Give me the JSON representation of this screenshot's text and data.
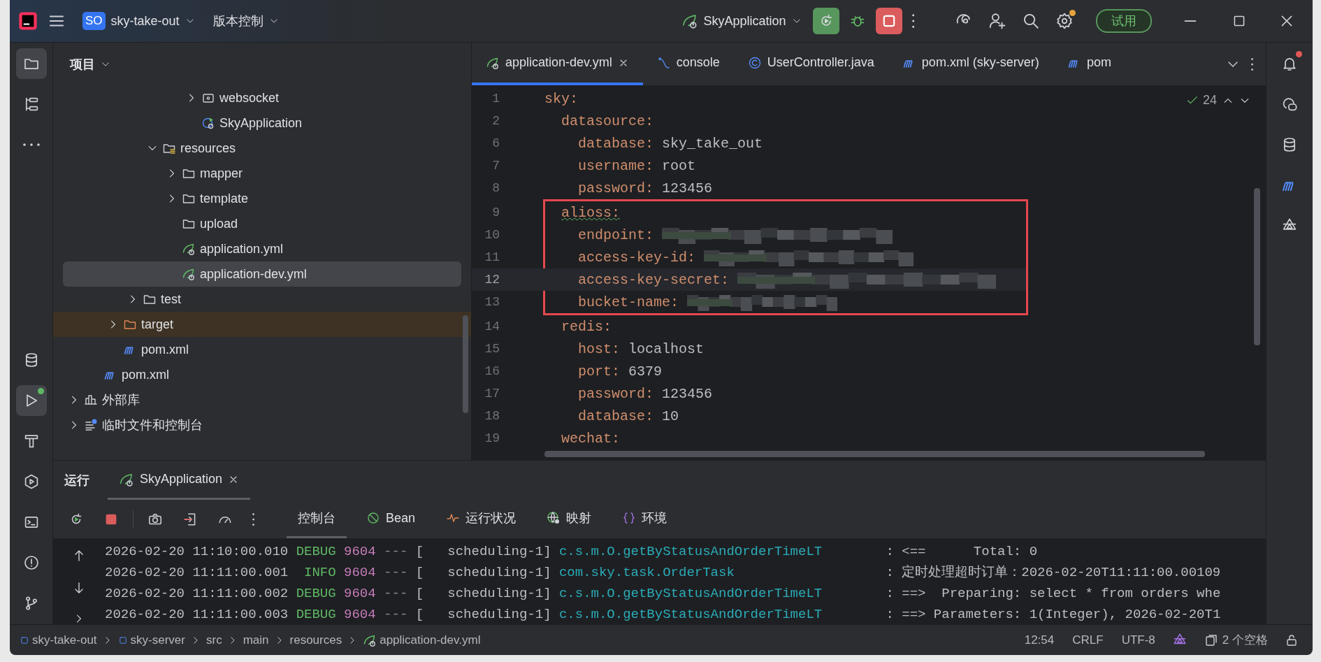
{
  "title_bar": {
    "project_initials": "SO",
    "project_name": "sky-take-out",
    "vcs_menu": "版本控制",
    "run_configuration": "SkyApplication",
    "trial_button": "试用",
    "settings_badge": true
  },
  "left_tools": [
    {
      "kind": "project",
      "selected": true,
      "badge": false
    },
    {
      "kind": "structure",
      "selected": false,
      "badge": false
    },
    {
      "kind": "more",
      "selected": false,
      "badge": false
    }
  ],
  "left_tools_bottom": [
    {
      "kind": "database",
      "selected": false,
      "badge": false
    },
    {
      "kind": "run",
      "selected": true,
      "badge": true
    },
    {
      "kind": "build",
      "selected": false,
      "badge": false
    },
    {
      "kind": "services",
      "selected": false,
      "badge": false
    },
    {
      "kind": "terminal",
      "selected": false,
      "badge": false
    },
    {
      "kind": "problems",
      "selected": false,
      "badge": false
    },
    {
      "kind": "git",
      "selected": false,
      "badge": false
    }
  ],
  "right_tools": [
    {
      "kind": "notifications",
      "selected": false,
      "badge": true
    },
    {
      "kind": "ai-chat",
      "selected": false,
      "badge": false
    },
    {
      "kind": "database",
      "selected": false,
      "badge": false
    },
    {
      "kind": "maven",
      "selected": false,
      "badge": false
    },
    {
      "kind": "ai",
      "selected": false,
      "badge": false
    }
  ],
  "project_panel": {
    "title": "项目",
    "tree": [
      {
        "children": [
          {
            "children": [
              {
                "children": [
                  {
                    "children": [
                      {
                        "children": [
                          {
                            "children": [
                              {
                                "label": "websocket",
                                "kind": "package",
                                "selected": false,
                                "expanded": false
                              },
                              {
                                "label": "SkyApplication",
                                "kind": "app",
                                "selected": false
                              }
                            ]
                          }
                        ]
                      },
                      {
                        "label": "resources",
                        "kind": "resources",
                        "selected": false,
                        "expanded": true,
                        "children": [
                          {
                            "label": "mapper",
                            "kind": "folder",
                            "selected": false,
                            "expanded": false
                          },
                          {
                            "label": "template",
                            "kind": "folder",
                            "selected": false,
                            "expanded": false
                          },
                          {
                            "label": "upload",
                            "kind": "folder",
                            "selected": false
                          },
                          {
                            "label": "application.yml",
                            "kind": "spring",
                            "selected": false
                          },
                          {
                            "label": "application-dev.yml",
                            "kind": "spring",
                            "selected": true
                          }
                        ]
                      }
                    ]
                  },
                  {
                    "label": "test",
                    "kind": "folder",
                    "selected": false,
                    "expanded": false
                  }
                ]
              },
              {
                "label": "target",
                "kind": "excluded",
                "selected": false,
                "expanded": false
              },
              {
                "label": "pom.xml",
                "kind": "maven",
                "selected": false
              }
            ]
          },
          {
            "label": "pom.xml",
            "kind": "maven",
            "selected": false
          }
        ]
      },
      {
        "label": "外部库",
        "kind": "library",
        "selected": false,
        "expanded": false
      },
      {
        "label": "临时文件和控制台",
        "kind": "scratch",
        "selected": false,
        "expanded": false
      }
    ]
  },
  "editor": {
    "tabs": [
      {
        "label": "application-dev.yml",
        "kind": "spring",
        "selected": true
      },
      {
        "label": "console",
        "kind": "sql",
        "selected": false
      },
      {
        "label": "UserController.java",
        "kind": "class",
        "selected": false
      },
      {
        "label": "pom.xml (sky-server)",
        "kind": "maven",
        "selected": false
      },
      {
        "label": "pom",
        "kind": "maven",
        "selected": false
      }
    ],
    "inspection_count": "24",
    "code": [
      {
        "line": "1",
        "key": "sky:",
        "current": false,
        "children": [
          {
            "line": "2",
            "key": "datasource:",
            "current": false,
            "children": [
              {
                "line": "6",
                "key": "database:",
                "value": "sky_take_out",
                "current": false
              },
              {
                "line": "7",
                "key": "username:",
                "value": "root",
                "current": false
              },
              {
                "line": "8",
                "key": "password:",
                "value": "123456",
                "current": false
              }
            ]
          },
          {
            "line": "9",
            "key": "alioss:",
            "current": false,
            "spell_warning": true,
            "annotated": true,
            "children": [
              {
                "line": "10",
                "key": "endpoint:",
                "current": false,
                "redacted": true
              },
              {
                "line": "11",
                "key": "access-key-id:",
                "current": false,
                "redacted": true
              },
              {
                "line": "12",
                "key": "access-key-secret:",
                "current": true,
                "redacted": true
              },
              {
                "line": "13",
                "key": "bucket-name:",
                "current": false,
                "redacted": true
              }
            ]
          },
          {
            "line": "14",
            "key": "redis:",
            "current": false,
            "children": [
              {
                "line": "15",
                "key": "host:",
                "value": "localhost",
                "current": false
              },
              {
                "line": "16",
                "key": "port:",
                "value": "6379",
                "current": false
              },
              {
                "line": "17",
                "key": "password:",
                "value": "123456",
                "current": false
              },
              {
                "line": "18",
                "key": "database:",
                "value": "10",
                "current": false
              }
            ]
          },
          {
            "line": "19",
            "key": "wechat:",
            "current": false
          }
        ]
      }
    ]
  },
  "run_panel": {
    "title": "运行",
    "tabs": [
      {
        "label": "SkyApplication",
        "selected": true
      }
    ],
    "sub_tabs": [
      {
        "label": "控制台",
        "kind": "console",
        "selected": true
      },
      {
        "label": "Bean",
        "kind": "bean",
        "selected": false
      },
      {
        "label": "运行状况",
        "kind": "health",
        "selected": false
      },
      {
        "label": "映射",
        "kind": "mappings",
        "selected": false
      },
      {
        "label": "环境",
        "kind": "environment",
        "selected": false
      }
    ],
    "console": [
      {
        "time": "2026-02-20 11:10:00.010",
        "level": "DEBUG",
        "pid": "9604",
        "separator": "---",
        "thread": "[   scheduling-1]",
        "logger": "c.s.m.O.getByStatusAndOrderTimeLT",
        "message": ": <==      Total: 0"
      },
      {
        "time": "2026-02-20 11:11:00.001",
        "level": "INFO",
        "pid": "9604",
        "separator": "---",
        "thread": "[   scheduling-1]",
        "logger": "com.sky.task.OrderTask",
        "message": ": 定时处理超时订单：2026-02-20T11:11:00.00109"
      },
      {
        "time": "2026-02-20 11:11:00.002",
        "level": "DEBUG",
        "pid": "9604",
        "separator": "---",
        "thread": "[   scheduling-1]",
        "logger": "c.s.m.O.getByStatusAndOrderTimeLT",
        "message": ": ==>  Preparing: select * from orders whe"
      },
      {
        "time": "2026-02-20 11:11:00.003",
        "level": "DEBUG",
        "pid": "9604",
        "separator": "---",
        "thread": "[   scheduling-1]",
        "logger": "c.s.m.O.getByStatusAndOrderTimeLT",
        "message": ": ==> Parameters: 1(Integer), 2026-02-20T1"
      }
    ]
  },
  "status_bar": {
    "breadcrumbs": [
      {
        "label": "sky-take-out",
        "kind": "module"
      },
      {
        "label": "sky-server",
        "kind": "module"
      },
      {
        "label": "src",
        "kind": "folder"
      },
      {
        "label": "main",
        "kind": "folder"
      },
      {
        "label": "resources",
        "kind": "folder"
      },
      {
        "label": "application-dev.yml",
        "kind": "spring"
      }
    ],
    "caret_position": "12:54",
    "line_separator": "CRLF",
    "encoding": "UTF-8",
    "indent": "2 个空格"
  }
}
